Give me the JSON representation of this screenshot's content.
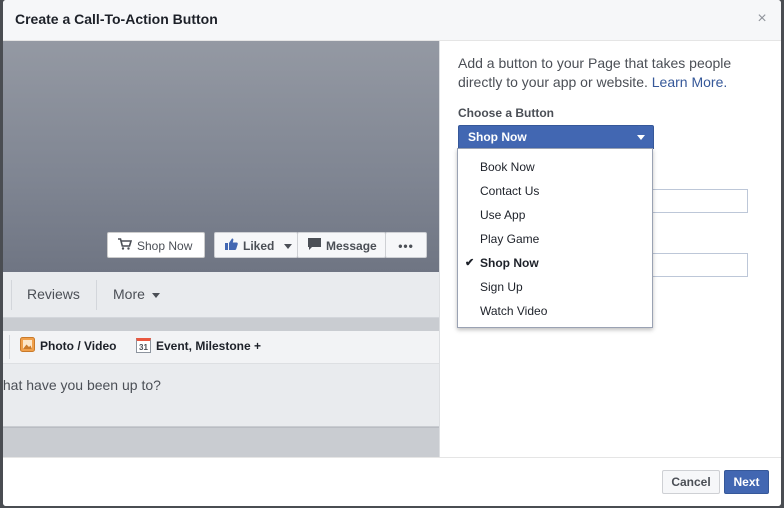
{
  "dialog": {
    "title": "Create a Call-To-Action Button",
    "close_glyph": "×"
  },
  "preview": {
    "cover_buttons": {
      "shop_now": "Shop Now",
      "liked": "Liked",
      "message": "Message",
      "more_dots": "•••"
    },
    "tabs": {
      "reviews": "Reviews",
      "more": "More"
    },
    "composer": {
      "photo_video": "Photo / Video",
      "event_milestone": "Event, Milestone +",
      "calendar_day": "31",
      "placeholder": "/hat have you been up to?"
    }
  },
  "panel": {
    "intro_text": "Add a button to your Page that takes people directly to your app or website. ",
    "learn_more": "Learn More.",
    "choose_label": "Choose a Button",
    "selected_value": "Shop Now"
  },
  "dropdown": {
    "options": [
      {
        "label": "Book Now",
        "selected": false
      },
      {
        "label": "Contact Us",
        "selected": false
      },
      {
        "label": "Use App",
        "selected": false
      },
      {
        "label": "Play Game",
        "selected": false
      },
      {
        "label": "Shop Now",
        "selected": true
      },
      {
        "label": "Sign Up",
        "selected": false
      },
      {
        "label": "Watch Video",
        "selected": false
      }
    ],
    "check_glyph": "✔"
  },
  "footer": {
    "cancel": "Cancel",
    "next": "Next"
  },
  "icons": {
    "cart": "cart-icon",
    "thumbs_up": "thumbs-up-icon",
    "message": "message-icon",
    "photo": "photo-icon",
    "calendar": "calendar-icon",
    "caret": "caret-down-icon",
    "close": "close-icon",
    "check": "checkmark-icon"
  },
  "colors": {
    "primary": "#4267b2",
    "link": "#365899",
    "text": "#4b4f56",
    "header_bg": "#f6f7f9"
  }
}
